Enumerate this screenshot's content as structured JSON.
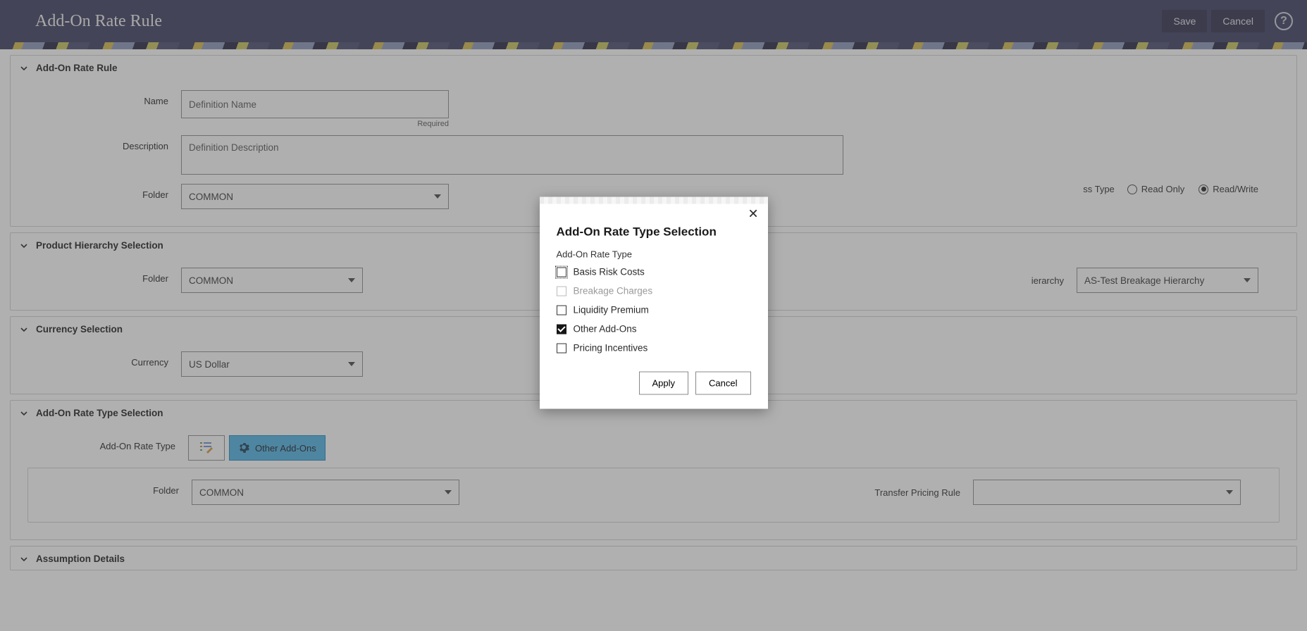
{
  "header": {
    "title": "Add-On Rate Rule",
    "save_label": "Save",
    "cancel_label": "Cancel"
  },
  "sections": {
    "rule": {
      "title": "Add-On Rate Rule",
      "name_label": "Name",
      "name_placeholder": "Definition Name",
      "name_helper": "Required",
      "desc_label": "Description",
      "desc_placeholder": "Definition Description",
      "folder_label": "Folder",
      "folder_value": "COMMON",
      "access_label": "ss Type",
      "access_read_only": "Read Only",
      "access_read_write": "Read/Write",
      "access_selected": "read_write"
    },
    "product": {
      "title": "Product Hierarchy Selection",
      "folder_label": "Folder",
      "folder_value": "COMMON",
      "hierarchy_label": "ierarchy",
      "hierarchy_value": "AS-Test Breakage Hierarchy"
    },
    "currency": {
      "title": "Currency Selection",
      "currency_label": "Currency",
      "currency_value": "US Dollar"
    },
    "ratetype": {
      "title": "Add-On Rate Type Selection",
      "ratetype_label": "Add-On Rate Type",
      "chip_label": "Other Add-Ons",
      "folder_label": "Folder",
      "folder_value": "COMMON",
      "tpr_label": "Transfer Pricing Rule",
      "tpr_value": ""
    },
    "assumption": {
      "title": "Assumption Details"
    }
  },
  "modal": {
    "title": "Add-On Rate Type Selection",
    "group_label": "Add-On Rate Type",
    "options": [
      {
        "label": "Basis Risk Costs",
        "checked": false,
        "disabled": false,
        "focused": true
      },
      {
        "label": "Breakage Charges",
        "checked": false,
        "disabled": true,
        "focused": false
      },
      {
        "label": "Liquidity Premium",
        "checked": false,
        "disabled": false,
        "focused": false
      },
      {
        "label": "Other Add-Ons",
        "checked": true,
        "disabled": false,
        "focused": false
      },
      {
        "label": "Pricing Incentives",
        "checked": false,
        "disabled": false,
        "focused": false
      }
    ],
    "apply_label": "Apply",
    "cancel_label": "Cancel"
  }
}
